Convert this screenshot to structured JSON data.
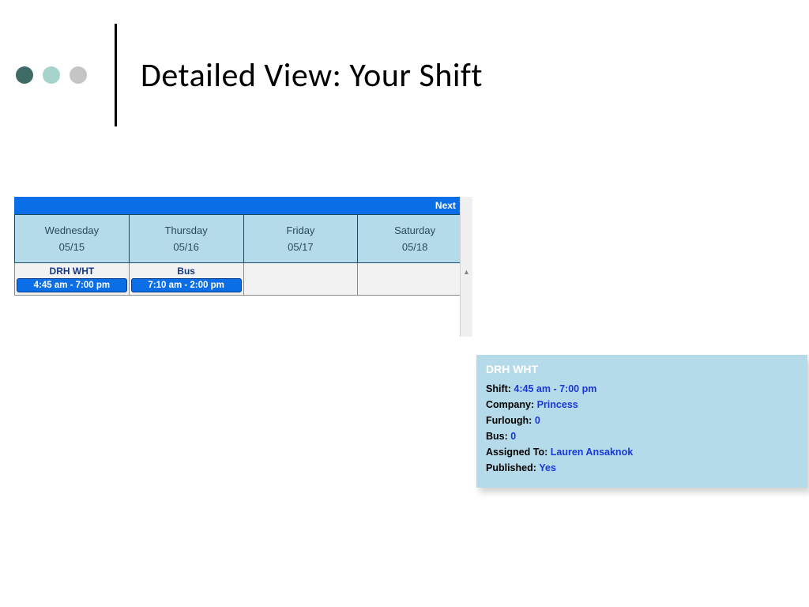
{
  "header": {
    "title": "Detailed View: Your Shift"
  },
  "calendar": {
    "next_label": "Next",
    "days": [
      {
        "name": "Wednesday",
        "date": "05/15"
      },
      {
        "name": "Thursday",
        "date": "05/16"
      },
      {
        "name": "Friday",
        "date": "05/17"
      },
      {
        "name": "Saturday",
        "date": "05/18"
      }
    ],
    "shifts": [
      {
        "label": "DRH WHT",
        "time": "4:45 am - 7:00 pm"
      },
      {
        "label": "Bus",
        "time": "7:10 am - 2:00 pm"
      }
    ]
  },
  "detail": {
    "title": "DRH WHT",
    "rows": {
      "shift": {
        "k": "Shift:",
        "v": "4:45 am - 7:00 pm"
      },
      "company": {
        "k": "Company:",
        "v": "Princess"
      },
      "furlough": {
        "k": "Furlough:",
        "v": "0"
      },
      "bus": {
        "k": "Bus:",
        "v": "0"
      },
      "assigned": {
        "k": "Assigned To:",
        "v": "Lauren Ansaknok"
      },
      "published": {
        "k": "Published:",
        "v": "Yes"
      }
    }
  }
}
